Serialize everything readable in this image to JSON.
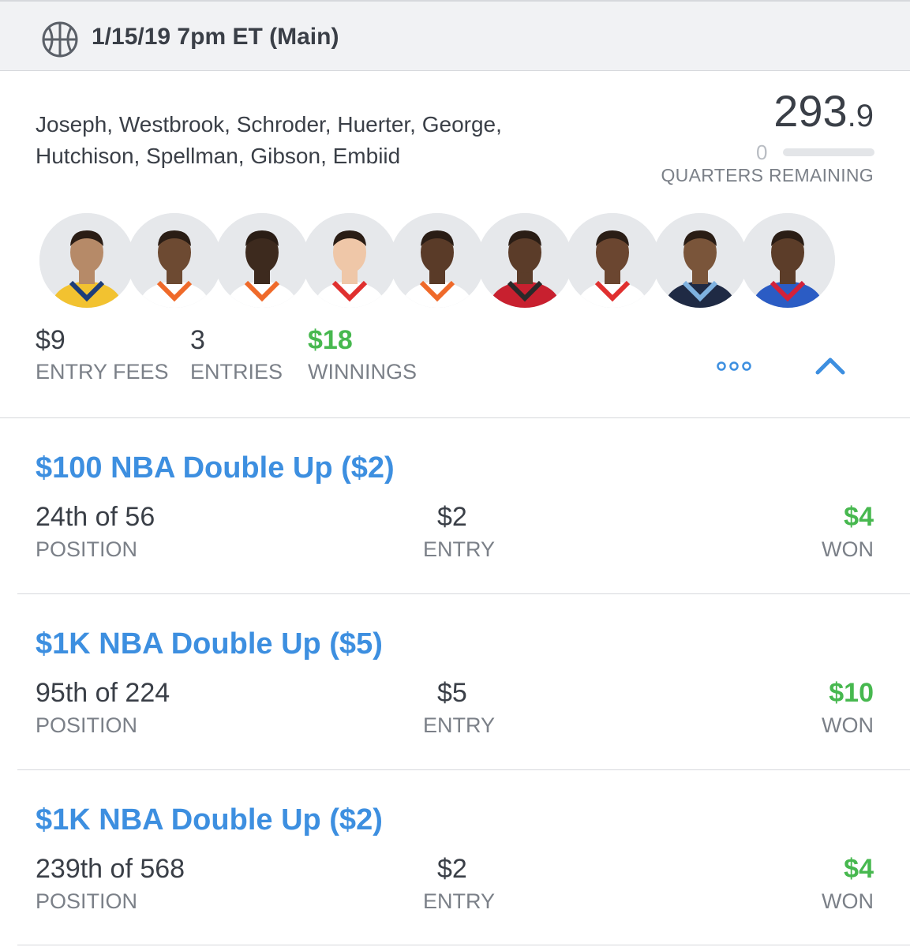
{
  "header": {
    "title": "1/15/19 7pm ET (Main)",
    "icon": "basketball-icon"
  },
  "lineup": {
    "roster_line1": "Joseph, Westbrook, Schroder, Huerter, George,",
    "roster_line2": "Hutchison, Spellman, Gibson, Embiid",
    "score_int": "293",
    "score_dec": ".9",
    "quarters_remaining": "0",
    "quarters_label": "QUARTERS REMAINING",
    "players": [
      {
        "jersey": "#f2c230",
        "jersey2": "#1d3d7a",
        "skin": "#b68a68"
      },
      {
        "jersey": "#ffffff",
        "jersey2": "#ef6a2a",
        "skin": "#6d4a32"
      },
      {
        "jersey": "#ffffff",
        "jersey2": "#ef6a2a",
        "skin": "#3d2a1e"
      },
      {
        "jersey": "#ffffff",
        "jersey2": "#e0302f",
        "skin": "#efc7a8"
      },
      {
        "jersey": "#ffffff",
        "jersey2": "#ef6a2a",
        "skin": "#5a3b28"
      },
      {
        "jersey": "#c8202f",
        "jersey2": "#2a2a2a",
        "skin": "#5b3c29"
      },
      {
        "jersey": "#ffffff",
        "jersey2": "#e0302f",
        "skin": "#6b4630"
      },
      {
        "jersey": "#1f2a44",
        "jersey2": "#7fb2e0",
        "skin": "#7a553a"
      },
      {
        "jersey": "#2b5cc4",
        "jersey2": "#d3213a",
        "skin": "#5c3d29"
      }
    ]
  },
  "stats": {
    "entry_fees_value": "$9",
    "entry_fees_label": "ENTRY FEES",
    "entries_value": "3",
    "entries_label": "ENTRIES",
    "winnings_value": "$18",
    "winnings_label": "WINNINGS"
  },
  "contests": [
    {
      "title": "$100 NBA Double Up ($2)",
      "position": "24th of 56",
      "position_label": "POSITION",
      "entry": "$2",
      "entry_label": "ENTRY",
      "won": "$4",
      "won_label": "WON"
    },
    {
      "title": "$1K NBA Double Up ($5)",
      "position": "95th of 224",
      "position_label": "POSITION",
      "entry": "$5",
      "entry_label": "ENTRY",
      "won": "$10",
      "won_label": "WON"
    },
    {
      "title": "$1K NBA Double Up ($2)",
      "position": "239th of 568",
      "position_label": "POSITION",
      "entry": "$2",
      "entry_label": "ENTRY",
      "won": "$4",
      "won_label": "WON"
    }
  ],
  "colors": {
    "link_blue": "#3d8fe0",
    "win_green": "#47b84f",
    "muted": "#7b8088",
    "text": "#3a3f47"
  }
}
